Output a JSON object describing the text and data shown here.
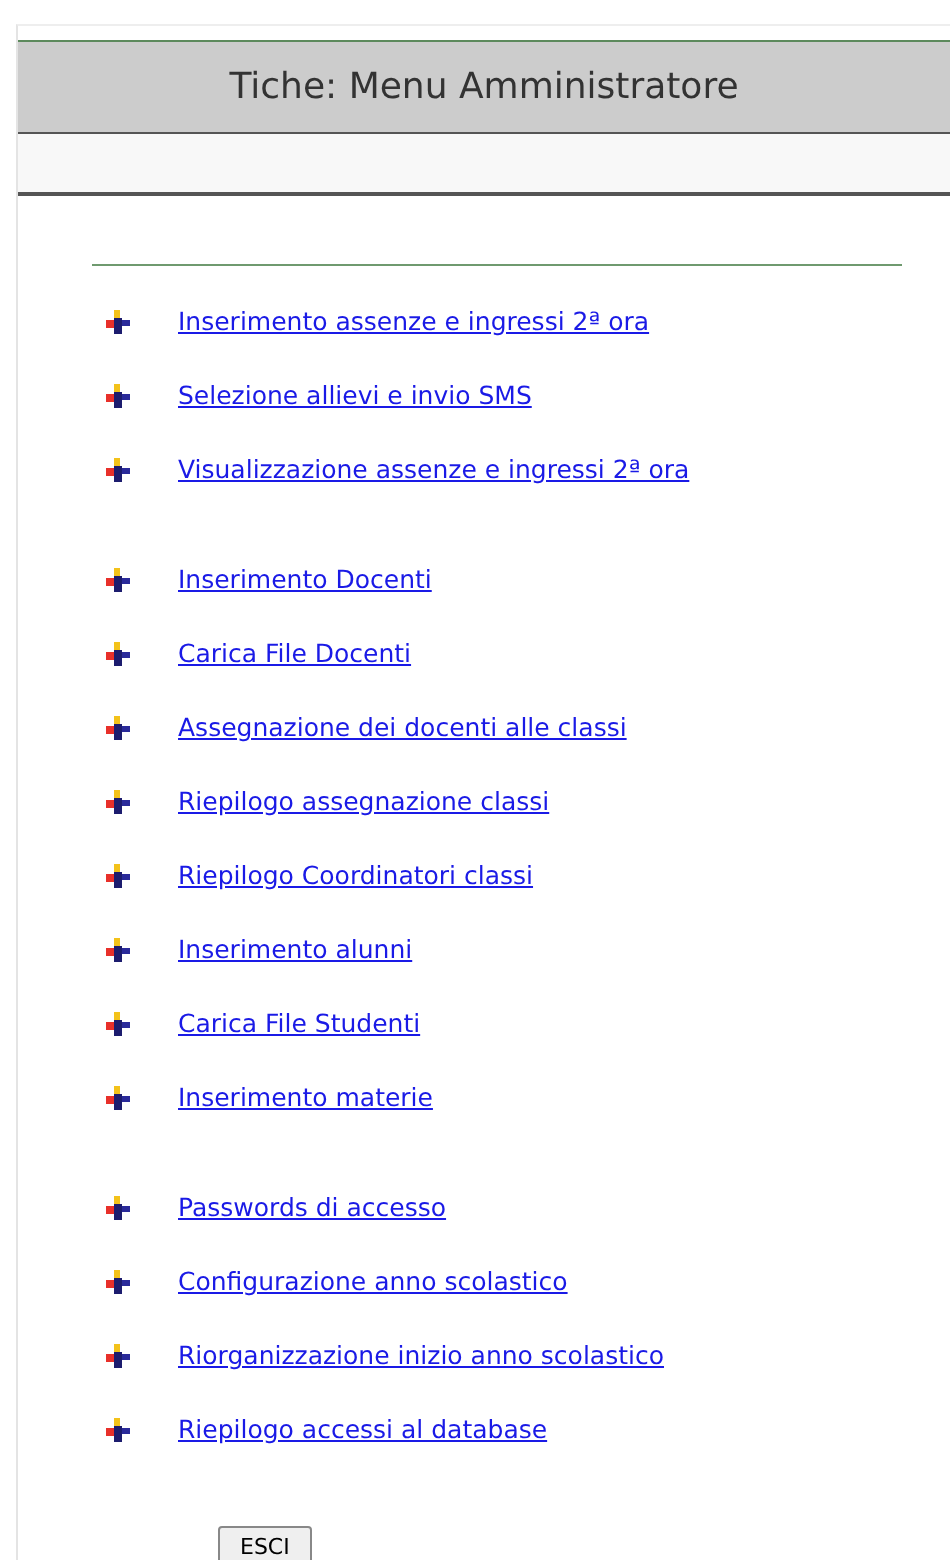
{
  "title": "Tiche: Menu Amministratore",
  "groups": [
    {
      "items": [
        {
          "label": "Inserimento assenze e ingressi 2ª ora"
        },
        {
          "label": "Selezione allievi e invio SMS"
        },
        {
          "label": "Visualizzazione assenze e ingressi 2ª ora"
        }
      ]
    },
    {
      "items": [
        {
          "label": "Inserimento Docenti"
        },
        {
          "label": "Carica File Docenti"
        },
        {
          "label": "Assegnazione dei docenti alle classi"
        },
        {
          "label": "Riepilogo assegnazione classi"
        },
        {
          "label": "Riepilogo Coordinatori classi"
        },
        {
          "label": "Inserimento alunni"
        },
        {
          "label": "Carica File Studenti"
        },
        {
          "label": "Inserimento materie"
        }
      ]
    },
    {
      "items": [
        {
          "label": "Passwords di accesso"
        },
        {
          "label": "Configurazione anno scolastico"
        },
        {
          "label": "Riorganizzazione inizio anno scolastico"
        },
        {
          "label": "Riepilogo accessi al database"
        }
      ]
    }
  ],
  "exit_button": "ESCI"
}
